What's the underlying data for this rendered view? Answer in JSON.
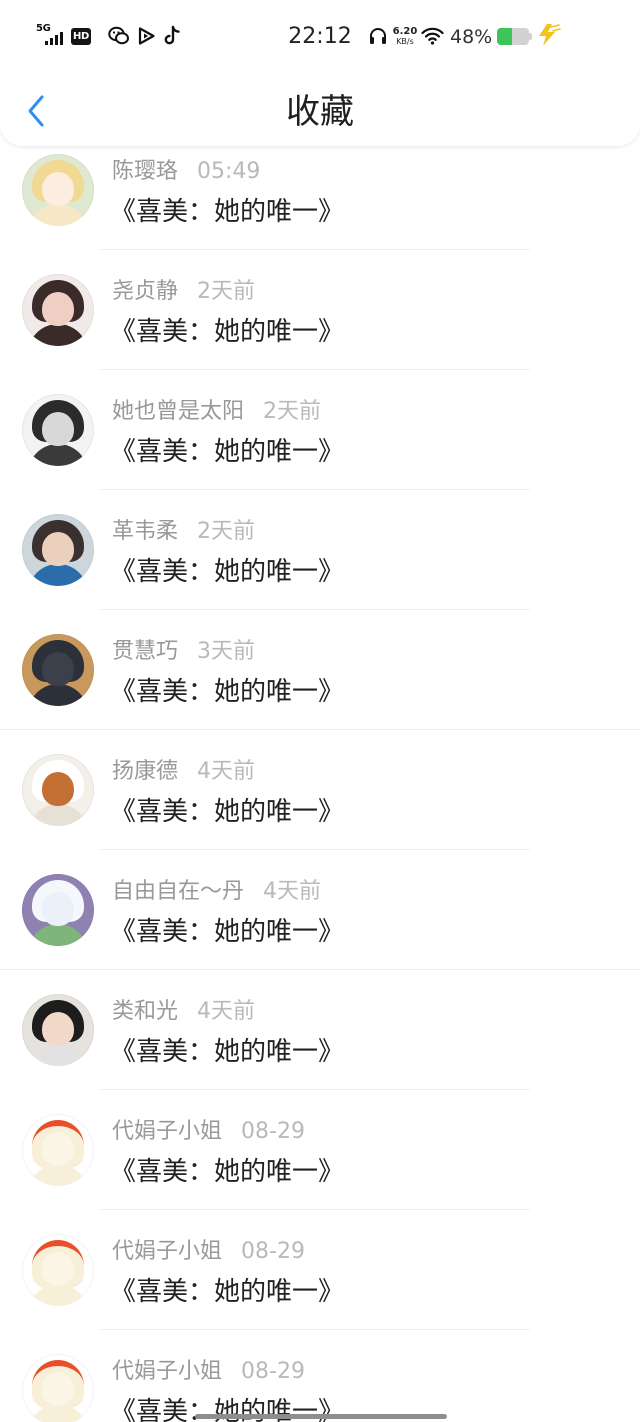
{
  "status_bar": {
    "network": "5G",
    "hd_badge": "HD",
    "app_icons": [
      "wechat-icon",
      "video-play-icon",
      "tiktok-icon"
    ],
    "time": "22:12",
    "net_speed": "6.20",
    "net_speed_unit": "KB/s",
    "battery": "48%",
    "right_icons": [
      "headphone-icon",
      "wifi-icon",
      "battery-icon",
      "charging-bolt-icon"
    ]
  },
  "header": {
    "back_icon": "chevron-left-icon",
    "title": "收藏"
  },
  "colors": {
    "accent": "#2f8ef4",
    "battery_fill": "#3ec45b",
    "charging": "#f2c21f",
    "name": "#999999",
    "time": "#b9b9b9",
    "title": "#222222"
  },
  "items": [
    {
      "name": "陈璎珞",
      "time": "05:49",
      "title": "《喜美：她的唯一》"
    },
    {
      "name": "尧贞静",
      "time": "2天前",
      "title": "《喜美：她的唯一》"
    },
    {
      "name": "她也曾是太阳",
      "time": "2天前",
      "title": "《喜美：她的唯一》"
    },
    {
      "name": "革韦柔",
      "time": "2天前",
      "title": "《喜美：她的唯一》"
    },
    {
      "name": "贯慧巧",
      "time": "3天前",
      "title": "《喜美：她的唯一》"
    },
    {
      "name": "扬康德",
      "time": "4天前",
      "title": "《喜美：她的唯一》"
    },
    {
      "name": "自由自在～丹",
      "time": "4天前",
      "title": "《喜美：她的唯一》"
    },
    {
      "name": "类和光",
      "time": "4天前",
      "title": "《喜美：她的唯一》"
    },
    {
      "name": "代娟子小姐",
      "time": "08-29",
      "title": "《喜美：她的唯一》"
    },
    {
      "name": "代娟子小姐",
      "time": "08-29",
      "title": "《喜美：她的唯一》"
    },
    {
      "name": "代娟子小姐",
      "time": "08-29",
      "title": "《喜美：她的唯一》"
    }
  ]
}
